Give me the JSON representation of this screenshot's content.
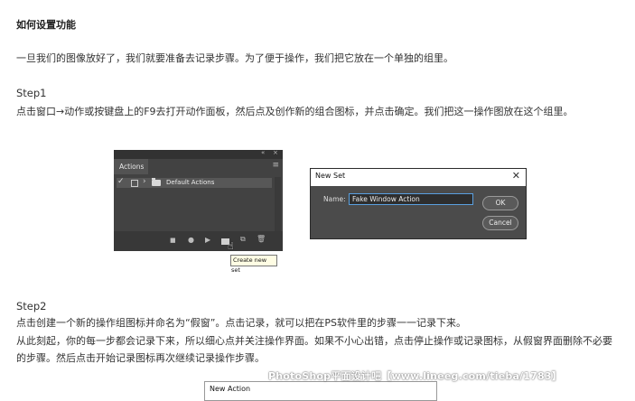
{
  "heading": "如何设置功能",
  "intro": "一旦我们的图像放好了，我们就要准备去记录步骤。为了便于操作，我们把它放在一个单独的组里。",
  "step1": {
    "title": "Step1",
    "text": "点击窗口→动作或按键盘上的F9去打开动作面板，然后点及创作新的组合图标，并点击确定。我们把这一操作图放在这个组里。"
  },
  "actions_panel": {
    "tab": "Actions",
    "row_label": "Default Actions",
    "tooltip": "Create new set",
    "icons": [
      "stop-icon",
      "record-icon",
      "play-icon",
      "new-set-icon",
      "new-action-icon",
      "trash-icon"
    ]
  },
  "new_set_dialog": {
    "title": "New Set",
    "name_label": "Name:",
    "name_value": "Fake Window Action",
    "ok": "OK",
    "cancel": "Cancel"
  },
  "step2": {
    "title": "Step2",
    "line1": "点击创建一个新的操作组图标并命名为“假窗”。点击记录，就可以把在PS软件里的步骤一一记录下来。",
    "line2": "从此刻起，你的每一步都会记录下来，所以细心点并关注操作界面。如果不小心出错，点击停止操作或记录图标，从假窗界面删除不必要",
    "line3": "的步骤。然后点击开始记录图标再次继续记录操作步骤。"
  },
  "new_action_dialog": {
    "title": "New Action"
  },
  "watermark": "PhotoShop平面设计吧【www.lineeg.com/tieba/1783】"
}
